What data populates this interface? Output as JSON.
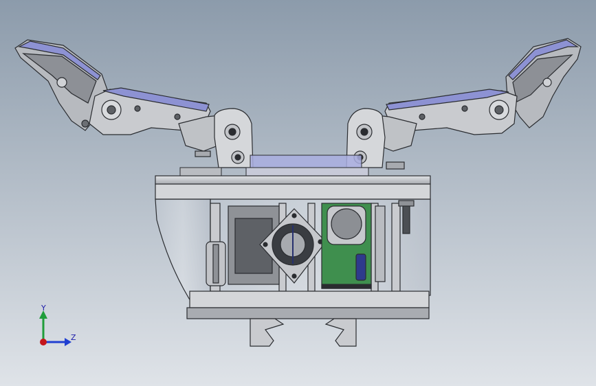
{
  "viewport": {
    "background_top": "#8c9bab",
    "background_bottom": "#dfe3e8"
  },
  "model": {
    "metal_light": "#d2d4d8",
    "metal_mid": "#a7aaaf",
    "metal_dark": "#6c6f74",
    "outline": "#2a2c30",
    "rubber_pad": "#8d92d3",
    "pcb_green": "#3f8f4e",
    "fan_frame": "#c6c8cc",
    "capacitor": "#2e3a8c",
    "transparent_shell": "#c2c9d2"
  },
  "triad": {
    "y_label": "Y",
    "z_label": "Z",
    "y_color": "#1f9d3a",
    "z_color": "#1f3fd1",
    "x_color": "#c4161c",
    "label_color": "#1a1aa8"
  }
}
